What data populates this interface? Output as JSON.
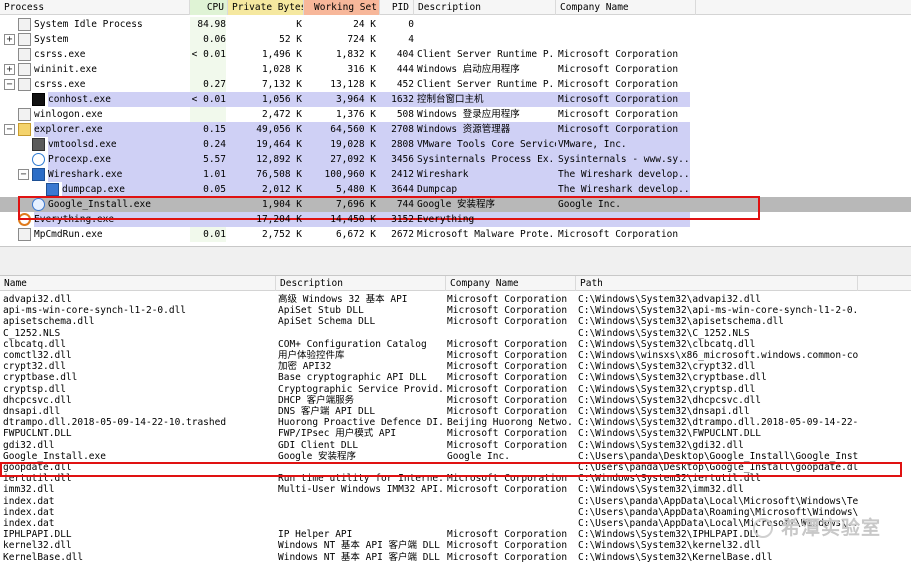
{
  "process_columns": {
    "process": "Process",
    "cpu": "CPU",
    "private_bytes": "Private Bytes",
    "working_set": "Working Set",
    "pid": "PID",
    "description": "Description",
    "company": "Company Name"
  },
  "processes": [
    {
      "name": "System Idle Process",
      "cpu": "84.98",
      "private": "K",
      "working": "24 K",
      "pid": "0",
      "desc": "",
      "company": "",
      "depth": 0,
      "toggle": "",
      "icon": "sys",
      "hl": false
    },
    {
      "name": "System",
      "cpu": "0.06",
      "private": "52 K",
      "working": "724 K",
      "pid": "4",
      "desc": "",
      "company": "",
      "depth": 0,
      "toggle": "+",
      "icon": "sys",
      "hl": false
    },
    {
      "name": "csrss.exe",
      "cpu": "< 0.01",
      "private": "1,496 K",
      "working": "1,832 K",
      "pid": "404",
      "desc": "Client Server Runtime P...",
      "company": "Microsoft Corporation",
      "depth": 0,
      "toggle": "",
      "icon": "sys",
      "hl": false
    },
    {
      "name": "wininit.exe",
      "cpu": "",
      "private": "1,028 K",
      "working": "316 K",
      "pid": "444",
      "desc": "Windows 启动应用程序",
      "company": "Microsoft Corporation",
      "depth": 0,
      "toggle": "+",
      "icon": "sys",
      "hl": false
    },
    {
      "name": "csrss.exe",
      "cpu": "0.27",
      "private": "7,132 K",
      "working": "13,128 K",
      "pid": "452",
      "desc": "Client Server Runtime P...",
      "company": "Microsoft Corporation",
      "depth": 0,
      "toggle": "-",
      "icon": "sys",
      "hl": false
    },
    {
      "name": "conhost.exe",
      "cpu": "< 0.01",
      "private": "1,056 K",
      "working": "3,964 K",
      "pid": "1632",
      "desc": "控制台窗口主机",
      "company": "Microsoft Corporation",
      "depth": 1,
      "toggle": "",
      "icon": "con",
      "hl": true
    },
    {
      "name": "winlogon.exe",
      "cpu": "",
      "private": "2,472 K",
      "working": "1,376 K",
      "pid": "508",
      "desc": "Windows 登录应用程序",
      "company": "Microsoft Corporation",
      "depth": 0,
      "toggle": "",
      "icon": "sys",
      "hl": false
    },
    {
      "name": "explorer.exe",
      "cpu": "0.15",
      "private": "49,056 K",
      "working": "64,560 K",
      "pid": "2708",
      "desc": "Windows 资源管理器",
      "company": "Microsoft Corporation",
      "depth": 0,
      "toggle": "-",
      "icon": "exp",
      "hl": true
    },
    {
      "name": "vmtoolsd.exe",
      "cpu": "0.24",
      "private": "19,464 K",
      "working": "19,028 K",
      "pid": "2808",
      "desc": "VMware Tools Core Service",
      "company": "VMware, Inc.",
      "depth": 1,
      "toggle": "",
      "icon": "vm",
      "hl": true
    },
    {
      "name": "Procexp.exe",
      "cpu": "5.57",
      "private": "12,892 K",
      "working": "27,092 K",
      "pid": "3456",
      "desc": "Sysinternals Process Ex...",
      "company": "Sysinternals - www.sy...",
      "depth": 1,
      "toggle": "",
      "icon": "proc",
      "hl": true
    },
    {
      "name": "Wireshark.exe",
      "cpu": "1.01",
      "private": "76,508 K",
      "working": "100,960 K",
      "pid": "2412",
      "desc": "Wireshark",
      "company": "The Wireshark develop...",
      "depth": 1,
      "toggle": "-",
      "icon": "shark",
      "hl": true
    },
    {
      "name": "dumpcap.exe",
      "cpu": "0.05",
      "private": "2,012 K",
      "working": "5,480 K",
      "pid": "3644",
      "desc": "Dumpcap",
      "company": "The Wireshark develop...",
      "depth": 2,
      "toggle": "",
      "icon": "dump",
      "hl": true
    },
    {
      "name": "Google_Install.exe",
      "cpu": "",
      "private": "1,904 K",
      "working": "7,696 K",
      "pid": "744",
      "desc": "Google 安装程序",
      "company": "Google Inc.",
      "depth": 1,
      "toggle": "",
      "icon": "goog",
      "hl": false,
      "selected": true
    },
    {
      "name": "Everything.exe",
      "cpu": "",
      "private": "17,204 K",
      "working": "14,450 K",
      "pid": "3152",
      "desc": "Everything",
      "company": "",
      "depth": 0,
      "toggle": "",
      "icon": "ev",
      "hl": true
    },
    {
      "name": "MpCmdRun.exe",
      "cpu": "0.01",
      "private": "2,752 K",
      "working": "6,672 K",
      "pid": "2672",
      "desc": "Microsoft Malware Prote...",
      "company": "Microsoft Corporation",
      "depth": 0,
      "toggle": "",
      "icon": "sys",
      "hl": false
    }
  ],
  "dll_columns": {
    "name": "Name",
    "description": "Description",
    "company": "Company Name",
    "path": "Path"
  },
  "dlls": [
    {
      "name": "advapi32.dll",
      "desc": "高级 Windows 32 基本 API",
      "company": "Microsoft Corporation",
      "path": "C:\\Windows\\System32\\advapi32.dll"
    },
    {
      "name": "api-ms-win-core-synch-l1-2-0.dll",
      "desc": "ApiSet Stub DLL",
      "company": "Microsoft Corporation",
      "path": "C:\\Windows\\System32\\api-ms-win-core-synch-l1-2-0.dll"
    },
    {
      "name": "apisetschema.dll",
      "desc": "ApiSet Schema DLL",
      "company": "Microsoft Corporation",
      "path": "C:\\Windows\\System32\\apisetschema.dll"
    },
    {
      "name": "C_1252.NLS",
      "desc": "",
      "company": "",
      "path": "C:\\Windows\\System32\\C_1252.NLS"
    },
    {
      "name": "clbcatq.dll",
      "desc": "COM+ Configuration Catalog",
      "company": "Microsoft Corporation",
      "path": "C:\\Windows\\System32\\clbcatq.dll"
    },
    {
      "name": "comctl32.dll",
      "desc": "用户体验控件库",
      "company": "Microsoft Corporation",
      "path": "C:\\Windows\\winsxs\\x86_microsoft.windows.common-co..."
    },
    {
      "name": "crypt32.dll",
      "desc": "加密 API32",
      "company": "Microsoft Corporation",
      "path": "C:\\Windows\\System32\\crypt32.dll"
    },
    {
      "name": "cryptbase.dll",
      "desc": "Base cryptographic API DLL",
      "company": "Microsoft Corporation",
      "path": "C:\\Windows\\System32\\cryptbase.dll"
    },
    {
      "name": "cryptsp.dll",
      "desc": "Cryptographic Service Provid...",
      "company": "Microsoft Corporation",
      "path": "C:\\Windows\\System32\\cryptsp.dll"
    },
    {
      "name": "dhcpcsvc.dll",
      "desc": "DHCP 客户端服务",
      "company": "Microsoft Corporation",
      "path": "C:\\Windows\\System32\\dhcpcsvc.dll"
    },
    {
      "name": "dnsapi.dll",
      "desc": "DNS 客户端 API DLL",
      "company": "Microsoft Corporation",
      "path": "C:\\Windows\\System32\\dnsapi.dll"
    },
    {
      "name": "dtrampo.dll.2018-05-09-14-22-10.trashed",
      "desc": "Huorong Proactive Defence DI...",
      "company": "Beijing Huorong Netwo...",
      "path": "C:\\Windows\\System32\\dtrampo.dll.2018-05-09-14-22-..."
    },
    {
      "name": "FWPUCLNT.DLL",
      "desc": "FWP/IPsec 用户模式 API",
      "company": "Microsoft Corporation",
      "path": "C:\\Windows\\System32\\FWPUCLNT.DLL"
    },
    {
      "name": "gdi32.dll",
      "desc": "GDI Client DLL",
      "company": "Microsoft Corporation",
      "path": "C:\\Windows\\System32\\gdi32.dll"
    },
    {
      "name": "Google_Install.exe",
      "desc": "Google 安装程序",
      "company": "Google Inc.",
      "path": "C:\\Users\\panda\\Desktop\\Google_Install\\Google_Inst..."
    },
    {
      "name": "goopdate.dll",
      "desc": "",
      "company": "",
      "path": "C:\\Users\\panda\\Desktop\\Google_Install\\goopdate.dll"
    },
    {
      "name": "iertutil.dll",
      "desc": "Run time utility for Interne...",
      "company": "Microsoft Corporation",
      "path": "C:\\Windows\\System32\\iertutil.dll"
    },
    {
      "name": "imm32.dll",
      "desc": "Multi-User Windows IMM32 API...",
      "company": "Microsoft Corporation",
      "path": "C:\\Windows\\System32\\imm32.dll"
    },
    {
      "name": "index.dat",
      "desc": "",
      "company": "",
      "path": "C:\\Users\\panda\\AppData\\Local\\Microsoft\\Windows\\Te..."
    },
    {
      "name": "index.dat",
      "desc": "",
      "company": "",
      "path": "C:\\Users\\panda\\AppData\\Roaming\\Microsoft\\Windows\\..."
    },
    {
      "name": "index.dat",
      "desc": "",
      "company": "",
      "path": "C:\\Users\\panda\\AppData\\Local\\Microsoft\\Windows\\..."
    },
    {
      "name": "IPHLPAPI.DLL",
      "desc": "IP Helper API",
      "company": "Microsoft Corporation",
      "path": "C:\\Windows\\System32\\IPHLPAPI.DLL"
    },
    {
      "name": "kernel32.dll",
      "desc": "Windows NT 基本 API 客户端 DLL",
      "company": "Microsoft Corporation",
      "path": "C:\\Windows\\System32\\kernel32.dll"
    },
    {
      "name": "KernelBase.dll",
      "desc": "Windows NT 基本 API 客户端 DLL",
      "company": "Microsoft Corporation",
      "path": "C:\\Windows\\System32\\KernelBase.dll"
    }
  ],
  "watermark": "希潭实验室",
  "colors": {
    "cpu_header": "#dff3d5",
    "private_header": "#f5e8a0",
    "working_header": "#f7b79a",
    "highlight_row": "#cfd0f5",
    "selected_row": "#b8b8b8",
    "red_box": "#e01212"
  }
}
